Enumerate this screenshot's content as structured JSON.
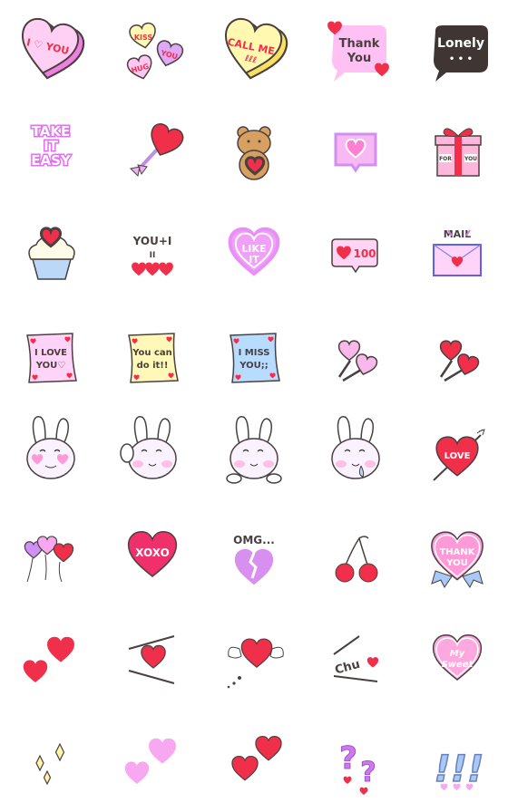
{
  "colors": {
    "outline": "#4a4040",
    "red": "#f0304a",
    "pink": "#ffc8f0",
    "lavender": "#e0a0f8",
    "yellow": "#fff4a8",
    "blue": "#b8dcff",
    "dark": "#3f3634"
  },
  "cells": [
    {
      "name": "candy-heart-i-love-you",
      "kind": "candy",
      "texts": [
        "I ♡ YOU"
      ],
      "fill": "#ffd0f4",
      "side": "#f080e0"
    },
    {
      "name": "candy-hearts-kiss-hug-you",
      "kind": "trio",
      "texts": [
        "KISS",
        "YOU",
        "HUG"
      ]
    },
    {
      "name": "candy-heart-call-me",
      "kind": "candy",
      "texts": [
        "CALL ME",
        "ℓℓℓ"
      ],
      "fill": "#fff8b0",
      "side": "#f8e060"
    },
    {
      "name": "thank-you-bubble",
      "kind": "bubble",
      "texts": [
        "Thank",
        "You"
      ],
      "fill": "#ffc0f4",
      "ink": "#4a4040",
      "hearts": true
    },
    {
      "name": "lonely-bubble",
      "kind": "bubble",
      "texts": [
        "Lonely",
        "• • •"
      ],
      "fill": "#3f3634",
      "ink": "#ffffff",
      "hearts": false
    },
    {
      "name": "take-it-easy-text",
      "kind": "neon",
      "texts": [
        "TAKE",
        "IT",
        "EASY"
      ]
    },
    {
      "name": "heart-lollipop",
      "kind": "lolly1",
      "texts": []
    },
    {
      "name": "teddy-bear-heart",
      "kind": "bear",
      "texts": []
    },
    {
      "name": "heart-message-box",
      "kind": "heartbox",
      "texts": []
    },
    {
      "name": "gift-box-for-you",
      "kind": "gift",
      "texts": [
        "FOR",
        "YOU"
      ]
    },
    {
      "name": "heart-cupcake",
      "kind": "cupcake",
      "texts": []
    },
    {
      "name": "you-plus-i-hearts",
      "kind": "equation",
      "texts": [
        "YOU+I",
        "II"
      ]
    },
    {
      "name": "like-it-neon-heart",
      "kind": "neonheart",
      "texts": [
        "LIKE",
        "IT"
      ]
    },
    {
      "name": "like-count-bubble",
      "kind": "likecount",
      "texts": [
        "100"
      ]
    },
    {
      "name": "mail-envelope",
      "kind": "mail",
      "texts": [
        "MAIL"
      ]
    },
    {
      "name": "note-i-love-you",
      "kind": "note",
      "texts": [
        "I LOVE",
        "YOU♡"
      ],
      "fill": "#ffd4f8"
    },
    {
      "name": "note-you-can-do-it",
      "kind": "note",
      "texts": [
        "You can",
        "do it!!"
      ],
      "fill": "#fff8b8"
    },
    {
      "name": "note-i-miss-you",
      "kind": "note",
      "texts": [
        "I MISS",
        "YOU;;"
      ],
      "fill": "#b8dcff"
    },
    {
      "name": "pink-heart-lollipops",
      "kind": "lollies",
      "texts": [],
      "fill": "#f8b8ec"
    },
    {
      "name": "red-heart-lollipops",
      "kind": "lollies",
      "texts": [],
      "fill": "#f0304a"
    },
    {
      "name": "bunny-heart-eyes",
      "kind": "bunny",
      "texts": [],
      "variant": "hearteyes"
    },
    {
      "name": "bunny-waving",
      "kind": "bunny",
      "texts": [],
      "variant": "wave"
    },
    {
      "name": "bunny-smiling",
      "kind": "bunny",
      "texts": [],
      "variant": "smile"
    },
    {
      "name": "bunny-drooling",
      "kind": "bunny",
      "texts": [],
      "variant": "drool"
    },
    {
      "name": "heart-arrow-love",
      "kind": "arrowheart",
      "texts": [
        "LOVE"
      ]
    },
    {
      "name": "heart-balloons",
      "kind": "balloons",
      "texts": []
    },
    {
      "name": "xoxo-heart",
      "kind": "bigheart",
      "texts": [
        "XOXO"
      ],
      "fill": "#f0306a"
    },
    {
      "name": "omg-broken-heart",
      "kind": "broken",
      "texts": [
        "OMG..."
      ]
    },
    {
      "name": "cherries",
      "kind": "cherries",
      "texts": []
    },
    {
      "name": "thank-you-heart-badge",
      "kind": "badge",
      "texts": [
        "THANK",
        "YOU"
      ]
    },
    {
      "name": "two-red-hearts",
      "kind": "twohearts",
      "texts": [],
      "fill": "#f0304a"
    },
    {
      "name": "heart-with-lines",
      "kind": "lineheart",
      "texts": []
    },
    {
      "name": "winged-heart",
      "kind": "winged",
      "texts": []
    },
    {
      "name": "chu-kiss",
      "kind": "chu",
      "texts": [
        "Chu"
      ]
    },
    {
      "name": "my-sweet-heart",
      "kind": "sweet",
      "texts": [
        "My",
        "Sweet"
      ]
    },
    {
      "name": "sparkles",
      "kind": "sparkles",
      "texts": []
    },
    {
      "name": "two-pink-hearts",
      "kind": "twohearts",
      "texts": [],
      "fill": "#f8a8f0"
    },
    {
      "name": "two-red-hearts-outlined",
      "kind": "twohearts2",
      "texts": []
    },
    {
      "name": "question-marks",
      "kind": "question",
      "texts": [
        "?",
        "?"
      ]
    },
    {
      "name": "exclamation-marks",
      "kind": "exclaim",
      "texts": [
        "!!!"
      ]
    }
  ]
}
